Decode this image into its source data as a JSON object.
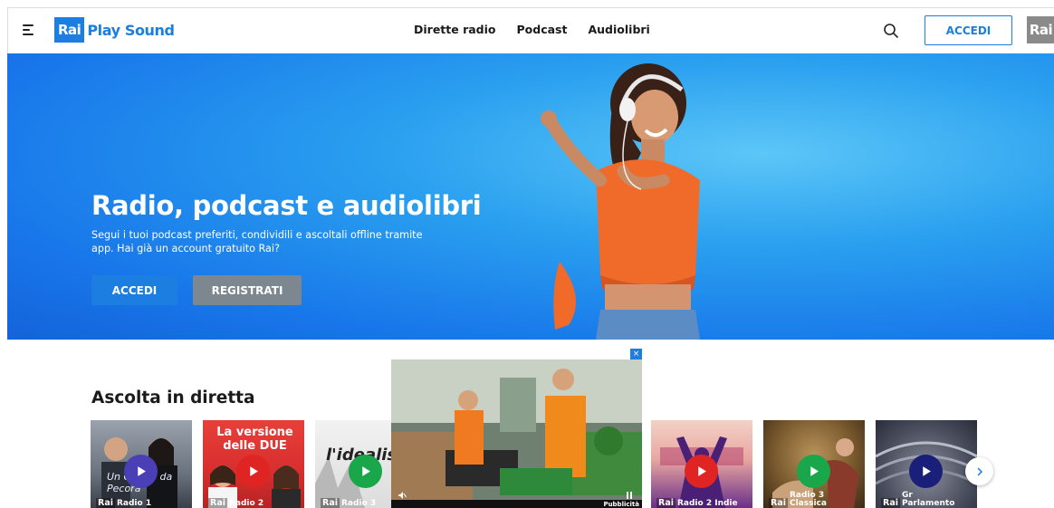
{
  "header": {
    "logo_rai": "Rai",
    "logo_text": "Play Sound",
    "nav": [
      "Dirette radio",
      "Podcast",
      "Audiolibri"
    ],
    "accedi": "ACCEDI",
    "rai_corner": "Rai"
  },
  "hero": {
    "title": "Radio, podcast e audiolibri",
    "subtitle": "Segui i tuoi podcast preferiti, condividili e ascoltali offline tramite app. Hai già un account gratuito Rai?",
    "accedi": "ACCEDI",
    "registrati": "REGISTRATI"
  },
  "live": {
    "title": "Ascolta in diretta",
    "cards": [
      {
        "rai": "Rai",
        "channel": "Radio 1",
        "play_color": "#4a3fb5",
        "art_text": "Un Giorno da Pecora"
      },
      {
        "rai": "Rai",
        "channel": "Radio 2",
        "play_color": "#e02424",
        "art_text": "La versione delle DUE"
      },
      {
        "rai": "Rai",
        "channel": "Radio 3",
        "play_color": "#1aa64a",
        "art_text": "l'idealis"
      },
      {
        "rai": "Rai",
        "channel": "Radio 2 Indie",
        "play_color": "#e02424",
        "art_text": ""
      },
      {
        "rai": "Rai",
        "channel": "Radio 3 Classica",
        "play_color": "#1aa64a",
        "art_text": ""
      },
      {
        "rai": "Rai",
        "channel": "Gr Parlamento",
        "play_color": "#1a1f7a",
        "art_text": ""
      }
    ]
  },
  "ad": {
    "close": "×",
    "label": "Pubblicità"
  },
  "colors": {
    "brand": "#1b7ee0",
    "gray_button": "#7d8790"
  }
}
